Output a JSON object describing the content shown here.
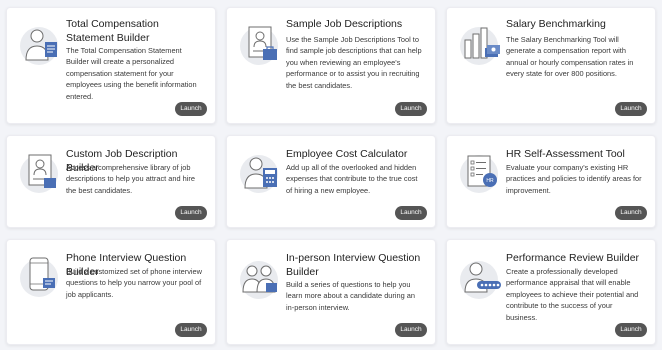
{
  "tools": [
    {
      "title": "Total Compensation Statement Builder",
      "description": "The Total Compensation Statement Builder will create a personalized compensation statement for your employees using the benefit information entered.",
      "button": "Launch",
      "icon": "person-with-certificate-icon"
    },
    {
      "title": "Sample Job Descriptions",
      "description": "Use the Sample Job Descriptions Tool to find sample job descriptions that can help you when reviewing an employee's performance or to assist you in recruiting the best candidates.",
      "button": "Launch",
      "icon": "job-profile-document-icon"
    },
    {
      "title": "Salary Benchmarking",
      "description": "The Salary Benchmarking Tool will generate a compensation report with annual or hourly compensation rates in every state for over 800 positions.",
      "button": "Launch",
      "icon": "bar-chart-money-icon"
    },
    {
      "title": "Custom Job Description Builder",
      "description": "Access a comprehensive library of job descriptions to help you attract and hire the best candidates.",
      "button": "Launch",
      "icon": "id-document-icon"
    },
    {
      "title": "Employee Cost Calculator",
      "description": "Add up all of the overlooked and hidden expenses that contribute to the true cost of hiring a new employee.",
      "button": "Launch",
      "icon": "person-calculator-icon"
    },
    {
      "title": "HR Self-Assessment Tool",
      "description": "Evaluate your company's existing HR practices and policies to identify areas for improvement.",
      "button": "Launch",
      "icon": "checklist-clipboard-icon"
    },
    {
      "title": "Phone Interview Question Builder",
      "description": "Build a customized set of phone interview questions to help you narrow your pool of job applicants.",
      "button": "Launch",
      "icon": "smartphone-icon"
    },
    {
      "title": "In-person Interview Question Builder",
      "description": "Build a series of questions to help you learn more about a candidate during an in-person interview.",
      "button": "Launch",
      "icon": "two-people-interview-icon"
    },
    {
      "title": "Performance Review Builder",
      "description": "Create a professionally developed performance appraisal that will enable employees to achieve their potential and contribute to the success of your business.",
      "button": "Launch",
      "icon": "person-rating-stars-icon"
    }
  ],
  "colors": {
    "accent": "#4a6fb5",
    "button": "#555555",
    "background": "#f3f4f8"
  }
}
